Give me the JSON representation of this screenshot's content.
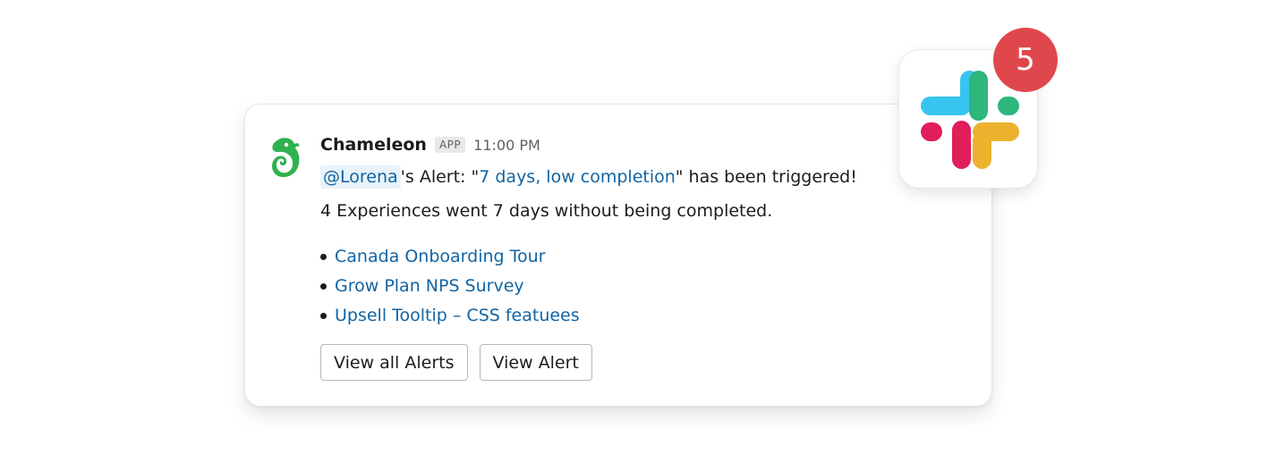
{
  "message": {
    "sender": "Chameleon",
    "app_badge": "APP",
    "time": "11:00 PM",
    "mention": "@Lorena",
    "alert_prefix": "'s Alert: \"",
    "alert_name": "7 days, low completion",
    "alert_suffix": "\" has been triggered!",
    "body": "4 Experiences went 7 days without being completed.",
    "experiences": [
      {
        "label": "Canada Onboarding Tour"
      },
      {
        "label": "Grow Plan NPS Survey"
      },
      {
        "label": "Upsell Tooltip – CSS featuees"
      }
    ],
    "buttons": {
      "view_all": "View all Alerts",
      "view_one": "View Alert"
    }
  },
  "slack": {
    "icon": "slack-logo-icon",
    "notification_count": "5"
  },
  "colors": {
    "link": "#1264a3",
    "mention_bg": "#e8f3fa",
    "badge": "#e0474c",
    "chameleon_green": "#2eb24f",
    "slack_blue": "#36c5f0",
    "slack_green": "#2eb67d",
    "slack_red": "#e01e5a",
    "slack_yellow": "#ecb22e"
  }
}
